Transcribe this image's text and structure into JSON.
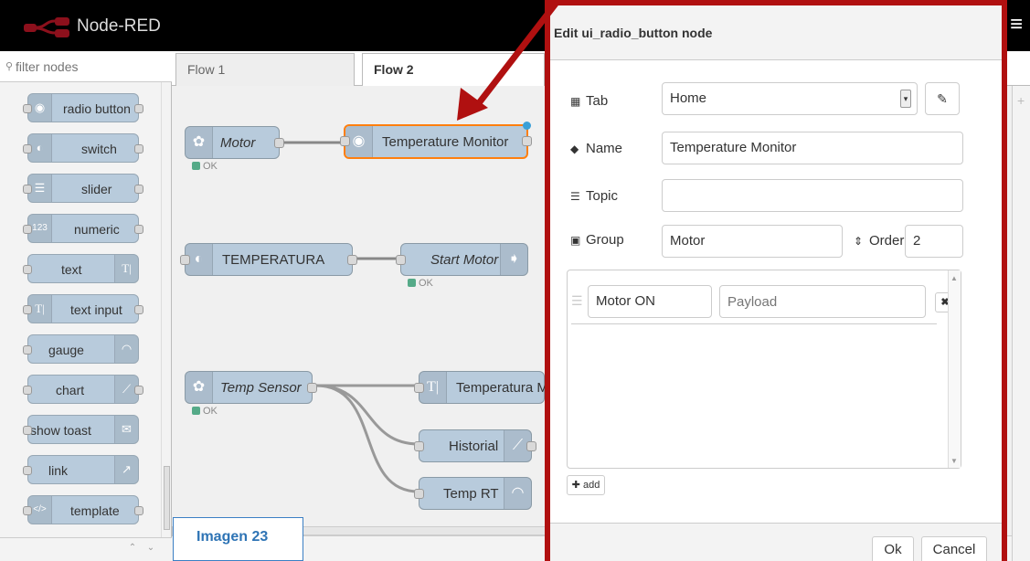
{
  "header": {
    "title": "Node-RED",
    "menu_icon": "hamburger-icon"
  },
  "palette": {
    "filter_placeholder": "filter nodes",
    "nodes": [
      {
        "label": "radio button",
        "icon": "radio-icon"
      },
      {
        "label": "switch",
        "icon": "switch-icon"
      },
      {
        "label": "slider",
        "icon": "slider-icon"
      },
      {
        "label": "numeric",
        "icon": "numeric-icon",
        "icon_text": "123"
      },
      {
        "label": "text",
        "icon": "text-icon",
        "icon_text": "T|"
      },
      {
        "label": "text input",
        "icon": "text-input-icon",
        "icon_text": "T|"
      },
      {
        "label": "gauge",
        "icon": "gauge-icon"
      },
      {
        "label": "chart",
        "icon": "chart-icon"
      },
      {
        "label": "show toast",
        "icon": "envelope-icon"
      },
      {
        "label": "link",
        "icon": "external-link-icon"
      },
      {
        "label": "template",
        "icon": "code-icon",
        "icon_text": "</>"
      }
    ]
  },
  "workspace": {
    "tabs": [
      {
        "label": "Flow 1",
        "active": false
      },
      {
        "label": "Flow 2",
        "active": true
      }
    ],
    "nodes": {
      "motor": {
        "label": "Motor",
        "status": "OK"
      },
      "temperature_monitor": {
        "label": "Temperature Monitor"
      },
      "temperatura": {
        "label": "TEMPERATURA"
      },
      "start_motor": {
        "label": "Start Motor",
        "status": "OK"
      },
      "temp_sensor": {
        "label": "Temp Sensor",
        "status": "OK"
      },
      "temperatura_m": {
        "label": "Temperatura M"
      },
      "historial": {
        "label": "Historial"
      },
      "temp_rt": {
        "label": "Temp RT"
      }
    },
    "caption": "Imagen  23"
  },
  "tray": {
    "title": "Edit ui_radio_button node",
    "fields": {
      "tab": {
        "label": "Tab",
        "value": "Home"
      },
      "name": {
        "label": "Name",
        "value": "Temperature Monitor"
      },
      "topic": {
        "label": "Topic",
        "value": ""
      },
      "group": {
        "label": "Group",
        "value": "Motor"
      },
      "order": {
        "label": "Order",
        "value": "2"
      }
    },
    "options": [
      {
        "label": "Motor ON",
        "payload_placeholder": "Payload"
      }
    ],
    "add_label": "add",
    "ok_label": "Ok",
    "cancel_label": "Cancel"
  },
  "colors": {
    "accent_red": "#b01010",
    "node_blue": "#b8cbdc",
    "selected_orange": "#ff7f0e",
    "status_green": "#5aaa88"
  }
}
